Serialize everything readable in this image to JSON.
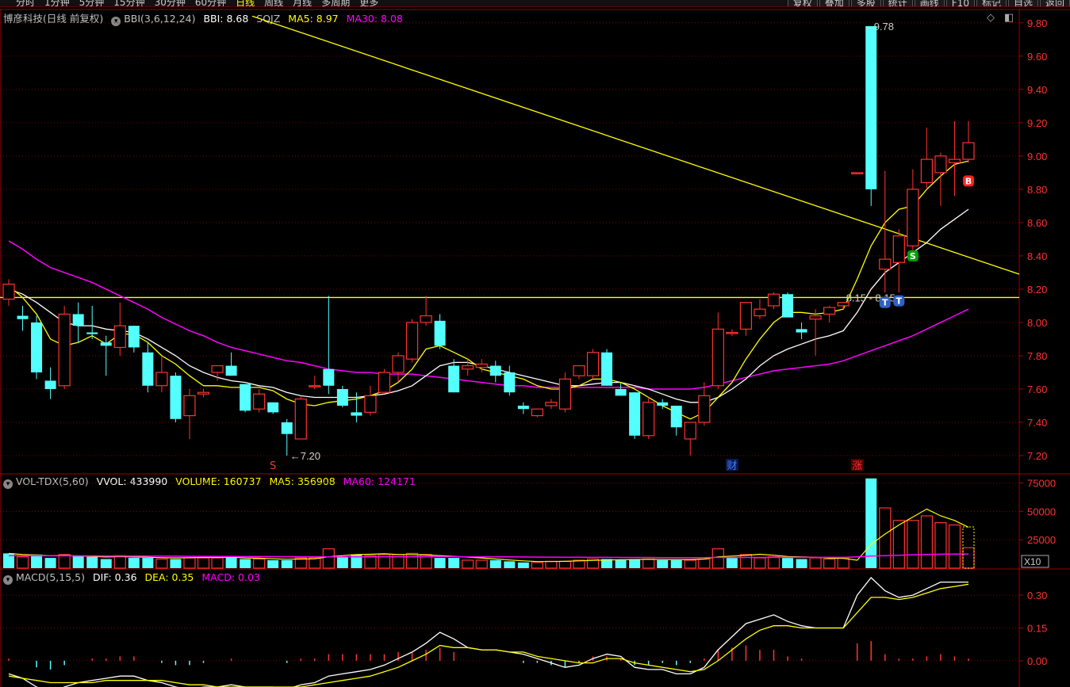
{
  "topbar": {
    "menu": [
      "分时",
      "1分钟",
      "5分钟",
      "15分钟",
      "30分钟",
      "60分钟",
      "日线",
      "周线",
      "月线",
      "多周期",
      "更多"
    ],
    "active": "日线",
    "buttons": [
      "复权",
      "叠加",
      "多股",
      "统计",
      "画线",
      "F10",
      "标记",
      "自选",
      "返回"
    ]
  },
  "main_legend": {
    "title": "博彦科技(日线 前复权)",
    "indicator": "BBI(3,6,12,24)",
    "bbi": "BBI: 8.68",
    "sqjz": "SQJZ",
    "ma5": "MA5: 8.97",
    "ma30": "MA30: 8.08"
  },
  "vol_legend": {
    "indicator": "VOL-TDX(5,60)",
    "vvol": "VVOL: 433990",
    "volume": "VOLUME: 160737",
    "ma5": "MA5: 356908",
    "ma60": "MA60: 124171"
  },
  "macd_legend": {
    "indicator": "MACD(5,15,5)",
    "dif": "DIF: 0.36",
    "dea": "DEA: 0.35",
    "macd": "MACD: 0.03"
  },
  "colors": {
    "up": "#ff3232",
    "down": "#54ffff",
    "ma5": "#ffff00",
    "ma30": "#ff00ff",
    "bbi": "#ffffff",
    "grid": "#800000",
    "axis_text": "#ff3232",
    "trend": "#ffff00"
  },
  "chart_data": [
    {
      "type": "candlestick",
      "title": "博彦科技(日线 前复权)",
      "ylim": [
        7.1,
        9.88
      ],
      "yticks": [
        "9.80",
        "9.60",
        "9.40",
        "9.20",
        "9.00",
        "8.80",
        "8.60",
        "8.40",
        "8.20",
        "8.00",
        "7.80",
        "7.60",
        "7.40",
        "7.20"
      ],
      "candles": [
        [
          8.14,
          8.26,
          8.1,
          8.23
        ],
        [
          8.04,
          8.1,
          7.95,
          8.02
        ],
        [
          8.0,
          8.04,
          7.66,
          7.7
        ],
        [
          7.65,
          7.73,
          7.54,
          7.6
        ],
        [
          7.62,
          8.1,
          7.6,
          8.05
        ],
        [
          8.05,
          8.12,
          7.88,
          7.98
        ],
        [
          7.94,
          8.1,
          7.9,
          7.93
        ],
        [
          7.88,
          7.92,
          7.68,
          7.86
        ],
        [
          7.85,
          8.12,
          7.8,
          7.98
        ],
        [
          7.98,
          7.98,
          7.82,
          7.85
        ],
        [
          7.82,
          7.88,
          7.58,
          7.62
        ],
        [
          7.62,
          7.8,
          7.58,
          7.7
        ],
        [
          7.68,
          7.7,
          7.4,
          7.42
        ],
        [
          7.44,
          7.6,
          7.3,
          7.56
        ],
        [
          7.57,
          7.6,
          7.55,
          7.58
        ],
        [
          7.7,
          7.74,
          7.65,
          7.74
        ],
        [
          7.74,
          7.82,
          7.68,
          7.68
        ],
        [
          7.63,
          7.63,
          7.46,
          7.47
        ],
        [
          7.48,
          7.6,
          7.46,
          7.57
        ],
        [
          7.52,
          7.52,
          7.45,
          7.46
        ],
        [
          7.4,
          7.42,
          7.2,
          7.33
        ],
        [
          7.3,
          7.56,
          7.3,
          7.54
        ],
        [
          7.62,
          7.68,
          7.6,
          7.62
        ],
        [
          7.72,
          8.16,
          7.57,
          7.62
        ],
        [
          7.6,
          7.62,
          7.49,
          7.5
        ],
        [
          7.46,
          7.58,
          7.4,
          7.44
        ],
        [
          7.46,
          7.62,
          7.44,
          7.56
        ],
        [
          7.58,
          7.72,
          7.58,
          7.7
        ],
        [
          7.7,
          7.82,
          7.64,
          7.8
        ],
        [
          7.78,
          8.02,
          7.76,
          8.0
        ],
        [
          8.0,
          8.16,
          7.98,
          8.04
        ],
        [
          8.01,
          8.05,
          7.84,
          7.86
        ],
        [
          7.74,
          7.78,
          7.58,
          7.58
        ],
        [
          7.72,
          7.78,
          7.68,
          7.74
        ],
        [
          7.73,
          7.78,
          7.7,
          7.75
        ],
        [
          7.74,
          7.77,
          7.64,
          7.68
        ],
        [
          7.7,
          7.74,
          7.56,
          7.58
        ],
        [
          7.5,
          7.52,
          7.45,
          7.48
        ],
        [
          7.44,
          7.48,
          7.43,
          7.48
        ],
        [
          7.5,
          7.54,
          7.48,
          7.52
        ],
        [
          7.48,
          7.7,
          7.46,
          7.66
        ],
        [
          7.68,
          7.72,
          7.66,
          7.74
        ],
        [
          7.68,
          7.84,
          7.66,
          7.82
        ],
        [
          7.82,
          7.84,
          7.62,
          7.62
        ],
        [
          7.6,
          7.64,
          7.56,
          7.56
        ],
        [
          7.58,
          7.58,
          7.3,
          7.32
        ],
        [
          7.32,
          7.55,
          7.3,
          7.52
        ],
        [
          7.52,
          7.54,
          7.48,
          7.5
        ],
        [
          7.5,
          7.5,
          7.32,
          7.37
        ],
        [
          7.3,
          7.4,
          7.2,
          7.4
        ],
        [
          7.4,
          7.64,
          7.38,
          7.56
        ],
        [
          7.62,
          8.06,
          7.6,
          7.96
        ],
        [
          7.94,
          7.96,
          7.92,
          7.94
        ],
        [
          7.96,
          8.1,
          7.92,
          8.12
        ],
        [
          8.04,
          8.14,
          8.02,
          8.08
        ],
        [
          8.1,
          8.18,
          8.08,
          8.17
        ],
        [
          8.17,
          8.18,
          8.03,
          8.03
        ],
        [
          7.96,
          8.0,
          7.9,
          7.94
        ],
        [
          8.02,
          8.08,
          7.8,
          8.04
        ],
        [
          8.05,
          8.1,
          8.0,
          8.09
        ],
        [
          8.1,
          8.12,
          8.08,
          8.12
        ],
        [
          8.9,
          8.9,
          8.9,
          8.9
        ],
        [
          9.78,
          9.78,
          8.7,
          8.8
        ],
        [
          8.32,
          8.91,
          8.18,
          8.38
        ],
        [
          8.36,
          8.56,
          8.18,
          8.52
        ],
        [
          8.46,
          8.92,
          8.42,
          8.8
        ],
        [
          8.84,
          9.17,
          8.8,
          8.98
        ],
        [
          8.9,
          9.02,
          8.7,
          9.0
        ],
        [
          8.96,
          9.21,
          8.76,
          8.98
        ],
        [
          8.98,
          9.21,
          8.96,
          9.08
        ]
      ],
      "ma5": [
        8.22,
        8.15,
        8.05,
        7.9,
        7.86,
        7.88,
        7.92,
        7.87,
        7.93,
        7.93,
        7.88,
        7.8,
        7.75,
        7.68,
        7.62,
        7.62,
        7.61,
        7.61,
        7.61,
        7.59,
        7.54,
        7.51,
        7.5,
        7.52,
        7.53,
        7.54,
        7.56,
        7.59,
        7.64,
        7.72,
        7.84,
        7.86,
        7.82,
        7.78,
        7.72,
        7.7,
        7.68,
        7.66,
        7.62,
        7.6,
        7.6,
        7.62,
        7.66,
        7.66,
        7.64,
        7.6,
        7.55,
        7.5,
        7.46,
        7.42,
        7.46,
        7.55,
        7.64,
        7.78,
        7.9,
        8.0,
        8.06,
        8.06,
        8.05,
        8.06,
        8.08,
        8.26,
        8.46,
        8.6,
        8.68,
        8.7,
        8.8,
        8.88,
        8.95,
        8.97
      ],
      "bbi": [
        8.2,
        8.17,
        8.12,
        8.06,
        8.0,
        7.98,
        7.98,
        7.96,
        7.95,
        7.94,
        7.9,
        7.85,
        7.8,
        7.74,
        7.7,
        7.67,
        7.65,
        7.64,
        7.62,
        7.61,
        7.58,
        7.56,
        7.55,
        7.55,
        7.55,
        7.55,
        7.56,
        7.57,
        7.59,
        7.62,
        7.68,
        7.74,
        7.76,
        7.76,
        7.74,
        7.72,
        7.7,
        7.68,
        7.66,
        7.64,
        7.62,
        7.62,
        7.63,
        7.64,
        7.64,
        7.62,
        7.6,
        7.57,
        7.54,
        7.52,
        7.52,
        7.55,
        7.6,
        7.66,
        7.74,
        7.8,
        7.84,
        7.87,
        7.9,
        7.92,
        7.95,
        8.06,
        8.2,
        8.3,
        8.36,
        8.42,
        8.48,
        8.56,
        8.62,
        8.68
      ],
      "ma30_x": [
        0,
        69
      ],
      "ma30": [
        8.49,
        8.44,
        8.38,
        8.33,
        8.3,
        8.27,
        8.24,
        8.2,
        8.16,
        8.12,
        8.08,
        8.03,
        7.99,
        7.95,
        7.92,
        7.88,
        7.85,
        7.83,
        7.81,
        7.79,
        7.77,
        7.76,
        7.74,
        7.72,
        7.71,
        7.7,
        7.7,
        7.69,
        7.69,
        7.69,
        7.68,
        7.67,
        7.66,
        7.65,
        7.64,
        7.63,
        7.62,
        7.62,
        7.61,
        7.61,
        7.61,
        7.61,
        7.61,
        7.61,
        7.61,
        7.61,
        7.6,
        7.6,
        7.6,
        7.6,
        7.61,
        7.63,
        7.65,
        7.67,
        7.69,
        7.71,
        7.72,
        7.73,
        7.74,
        7.75,
        7.77,
        7.8,
        7.83,
        7.86,
        7.89,
        7.92,
        7.96,
        8.0,
        8.04,
        8.08
      ],
      "hline": 8.15,
      "trendline": [
        [
          9.84,
          8.29
        ]
      ],
      "annotations": [
        {
          "text": "9.78",
          "index": 61,
          "value": 9.78
        },
        {
          "text": "7.20",
          "index": 20,
          "value": 7.2
        },
        {
          "text": "8.15 - 8.15",
          "index": 61,
          "value": 8.15
        }
      ],
      "signals": [
        {
          "label": "S",
          "index": 65,
          "value": 8.4,
          "color": "#00a000"
        },
        {
          "label": "B",
          "index": 69,
          "value": 8.85,
          "color": "#ff2020"
        },
        {
          "label": "T",
          "index": 63,
          "value": 8.12,
          "color": "#3060c0"
        },
        {
          "label": "T",
          "index": 64,
          "value": 8.13,
          "color": "#3060c0"
        }
      ],
      "markers": [
        {
          "label": "S",
          "index": 19,
          "color": "#ff3232"
        },
        {
          "label": "财",
          "index": 52,
          "color": "#4080ff"
        },
        {
          "label": "涨",
          "index": 61,
          "color": "#ff3232"
        }
      ]
    },
    {
      "type": "bar",
      "title": "VOL-TDX(5,60)",
      "ylim": [
        0,
        83000
      ],
      "yticks": [
        "75000",
        "50000",
        "25000"
      ],
      "unit_label": "X10",
      "values": [
        13000,
        10000,
        12000,
        9000,
        12000,
        11000,
        10000,
        8000,
        11000,
        9000,
        9000,
        8000,
        8000,
        9000,
        9000,
        9000,
        10000,
        8000,
        8000,
        7000,
        7000,
        9000,
        9000,
        17000,
        10000,
        12000,
        11000,
        12000,
        12000,
        13000,
        12000,
        9000,
        9000,
        7000,
        7000,
        7000,
        6000,
        5000,
        5000,
        6000,
        6000,
        7000,
        8000,
        8000,
        7000,
        8000,
        8000,
        7000,
        7000,
        7000,
        8000,
        17000,
        9000,
        12000,
        9000,
        10000,
        9000,
        8000,
        9000,
        8000,
        9000,
        0,
        79000,
        53000,
        42000,
        42000,
        46000,
        40000,
        38000,
        18000
      ],
      "up": [
        0,
        1,
        0,
        0,
        1,
        0,
        0,
        0,
        1,
        0,
        0,
        1,
        0,
        1,
        1,
        1,
        0,
        0,
        1,
        0,
        0,
        1,
        1,
        1,
        0,
        0,
        1,
        1,
        1,
        1,
        1,
        0,
        0,
        1,
        1,
        0,
        0,
        0,
        1,
        1,
        1,
        1,
        1,
        0,
        0,
        0,
        1,
        0,
        0,
        1,
        1,
        1,
        0,
        1,
        1,
        1,
        0,
        0,
        1,
        1,
        1,
        1,
        0,
        1,
        1,
        1,
        1,
        1,
        1,
        1
      ],
      "ma5": [
        13000,
        12000,
        11500,
        11000,
        11200,
        10800,
        10400,
        9800,
        10200,
        9800,
        9600,
        9200,
        9000,
        9200,
        9400,
        9400,
        9600,
        9000,
        8800,
        8200,
        7800,
        8000,
        8200,
        10000,
        11000,
        12000,
        12200,
        12600,
        12000,
        12000,
        11600,
        11000,
        10400,
        9600,
        9000,
        8000,
        7200,
        6400,
        5800,
        5800,
        6000,
        6400,
        6800,
        7200,
        7400,
        7600,
        7800,
        7600,
        7600,
        7600,
        8000,
        10000,
        10600,
        11200,
        12200,
        11400,
        10200,
        9800,
        9600,
        8800,
        8600,
        7000,
        21000,
        30000,
        38000,
        45000,
        52000,
        46000,
        42000,
        36000
      ],
      "ma60": [
        11000,
        11000,
        11000,
        10900,
        10900,
        10800,
        10800,
        10700,
        10700,
        10600,
        10600,
        10500,
        10500,
        10400,
        10400,
        10300,
        10300,
        10200,
        10200,
        10100,
        10100,
        10000,
        10000,
        10000,
        10000,
        10000,
        10000,
        10100,
        10100,
        10100,
        10100,
        10100,
        10100,
        10000,
        10000,
        9900,
        9900,
        9800,
        9700,
        9700,
        9600,
        9600,
        9500,
        9500,
        9400,
        9400,
        9400,
        9300,
        9300,
        9300,
        9300,
        9400,
        9400,
        9400,
        9400,
        9500,
        9500,
        9500,
        9500,
        9500,
        9500,
        10000,
        10600,
        11000,
        11400,
        11700,
        12000,
        12300,
        12400,
        12417
      ]
    },
    {
      "type": "line",
      "title": "MACD(5,15,5)",
      "ylim": [
        -0.12,
        0.42
      ],
      "yticks": [
        "0.30",
        "0.15",
        "0.00"
      ],
      "dif": [
        -0.06,
        -0.08,
        -0.12,
        -0.14,
        -0.12,
        -0.1,
        -0.09,
        -0.08,
        -0.07,
        -0.07,
        -0.09,
        -0.1,
        -0.12,
        -0.13,
        -0.12,
        -0.12,
        -0.11,
        -0.12,
        -0.12,
        -0.12,
        -0.13,
        -0.11,
        -0.1,
        -0.07,
        -0.06,
        -0.05,
        -0.04,
        -0.02,
        0.01,
        0.04,
        0.08,
        0.13,
        0.1,
        0.06,
        0.05,
        0.05,
        0.04,
        0.03,
        0.01,
        -0.01,
        -0.03,
        -0.02,
        0.01,
        0.03,
        0.02,
        -0.03,
        -0.04,
        -0.04,
        -0.06,
        -0.06,
        -0.03,
        0.05,
        0.11,
        0.17,
        0.19,
        0.21,
        0.18,
        0.16,
        0.15,
        0.15,
        0.15,
        0.3,
        0.38,
        0.32,
        0.29,
        0.3,
        0.33,
        0.36,
        0.36,
        0.36
      ],
      "dea": [
        -0.07,
        -0.08,
        -0.09,
        -0.1,
        -0.1,
        -0.1,
        -0.1,
        -0.09,
        -0.09,
        -0.09,
        -0.09,
        -0.09,
        -0.1,
        -0.11,
        -0.11,
        -0.12,
        -0.12,
        -0.12,
        -0.12,
        -0.12,
        -0.12,
        -0.12,
        -0.11,
        -0.1,
        -0.09,
        -0.08,
        -0.07,
        -0.05,
        -0.03,
        0.0,
        0.03,
        0.07,
        0.06,
        0.06,
        0.05,
        0.05,
        0.04,
        0.04,
        0.02,
        0.01,
        0.0,
        -0.01,
        -0.01,
        0.01,
        0.01,
        -0.01,
        -0.02,
        -0.03,
        -0.04,
        -0.05,
        -0.04,
        0.0,
        0.05,
        0.1,
        0.14,
        0.16,
        0.16,
        0.15,
        0.15,
        0.15,
        0.15,
        0.22,
        0.29,
        0.29,
        0.28,
        0.29,
        0.31,
        0.33,
        0.34,
        0.35
      ],
      "macd": [
        0.01,
        0.0,
        -0.03,
        -0.04,
        -0.02,
        0.0,
        0.01,
        0.01,
        0.02,
        0.02,
        0.0,
        -0.01,
        -0.02,
        -0.02,
        -0.01,
        0.0,
        0.01,
        0.0,
        0.0,
        0.0,
        -0.01,
        0.01,
        0.01,
        0.03,
        0.03,
        0.03,
        0.03,
        0.03,
        0.04,
        0.04,
        0.05,
        0.06,
        0.04,
        0.0,
        0.0,
        0.0,
        0.0,
        -0.01,
        -0.01,
        -0.02,
        -0.03,
        -0.01,
        0.02,
        0.02,
        0.01,
        -0.02,
        -0.02,
        -0.01,
        -0.02,
        -0.01,
        0.01,
        0.05,
        0.06,
        0.07,
        0.05,
        0.05,
        0.02,
        0.01,
        0.0,
        0.0,
        0.0,
        0.08,
        0.09,
        0.03,
        0.01,
        0.01,
        0.02,
        0.03,
        0.02,
        0.01
      ]
    }
  ]
}
